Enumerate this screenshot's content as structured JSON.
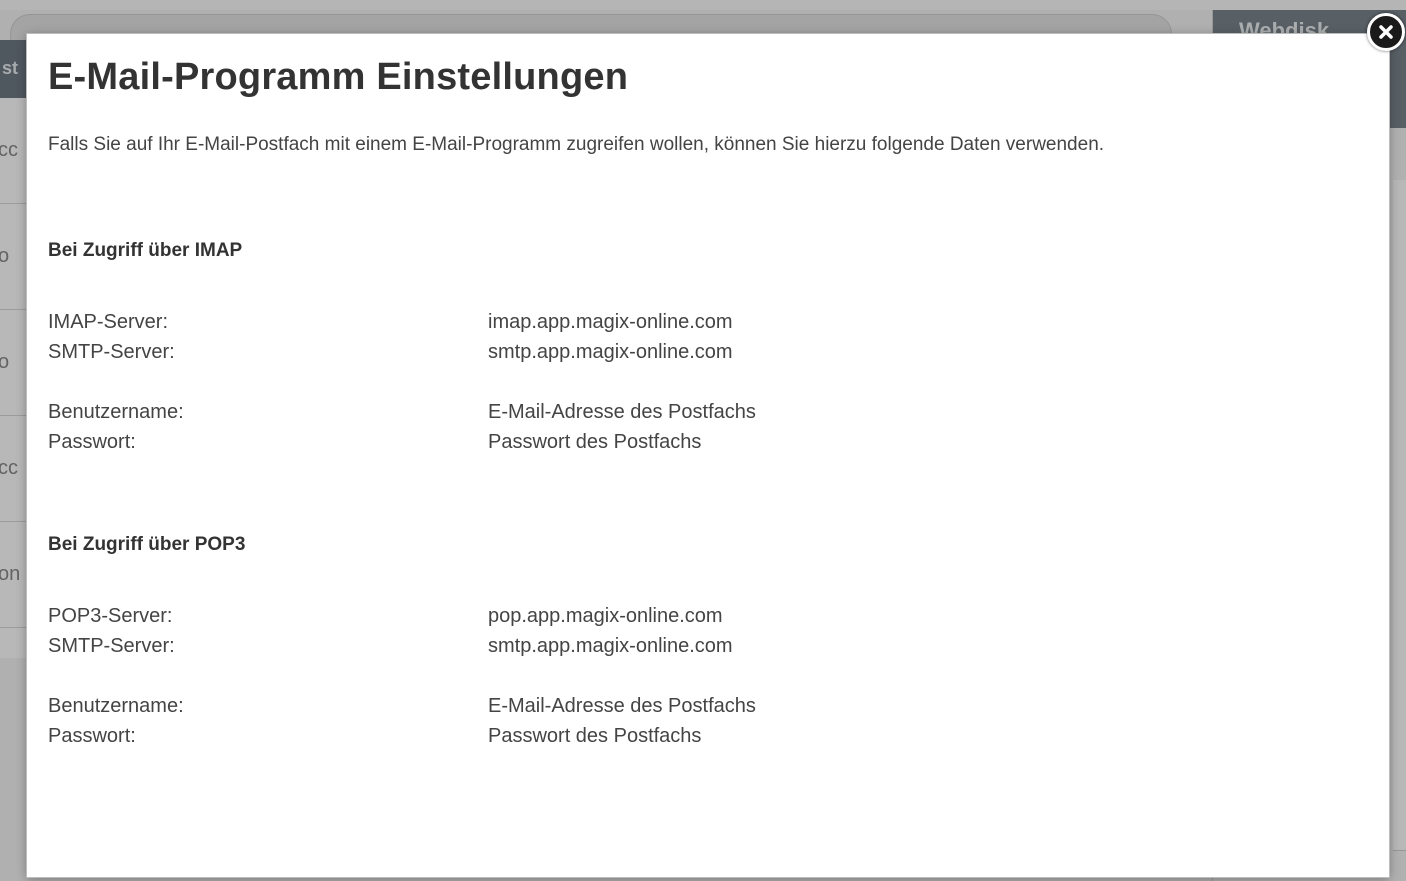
{
  "background": {
    "left_header_text": "st",
    "left_items": [
      "cc",
      "o",
      "o",
      "cc",
      "on"
    ],
    "right_header_text": "Webdisk"
  },
  "modal": {
    "title": "E-Mail-Programm Einstellungen",
    "intro": "Falls Sie auf Ihr E-Mail-Postfach mit einem E-Mail-Programm zugreifen wollen, können Sie hierzu folgende Daten verwenden.",
    "imap": {
      "heading": "Bei Zugriff über IMAP",
      "rows": [
        {
          "label": "IMAP-Server:",
          "value": "imap.app.magix-online.com"
        },
        {
          "label": "SMTP-Server:",
          "value": "smtp.app.magix-online.com"
        },
        {
          "label": "Benutzername:",
          "value": "E-Mail-Adresse des Postfachs"
        },
        {
          "label": "Passwort:",
          "value": "Passwort des Postfachs"
        }
      ]
    },
    "pop3": {
      "heading": "Bei Zugriff über POP3",
      "rows": [
        {
          "label": "POP3-Server:",
          "value": "pop.app.magix-online.com"
        },
        {
          "label": "SMTP-Server:",
          "value": "smtp.app.magix-online.com"
        },
        {
          "label": "Benutzername:",
          "value": "E-Mail-Adresse des Postfachs"
        },
        {
          "label": "Passwort:",
          "value": "Passwort des Postfachs"
        }
      ]
    },
    "close_icon": "close-icon"
  }
}
